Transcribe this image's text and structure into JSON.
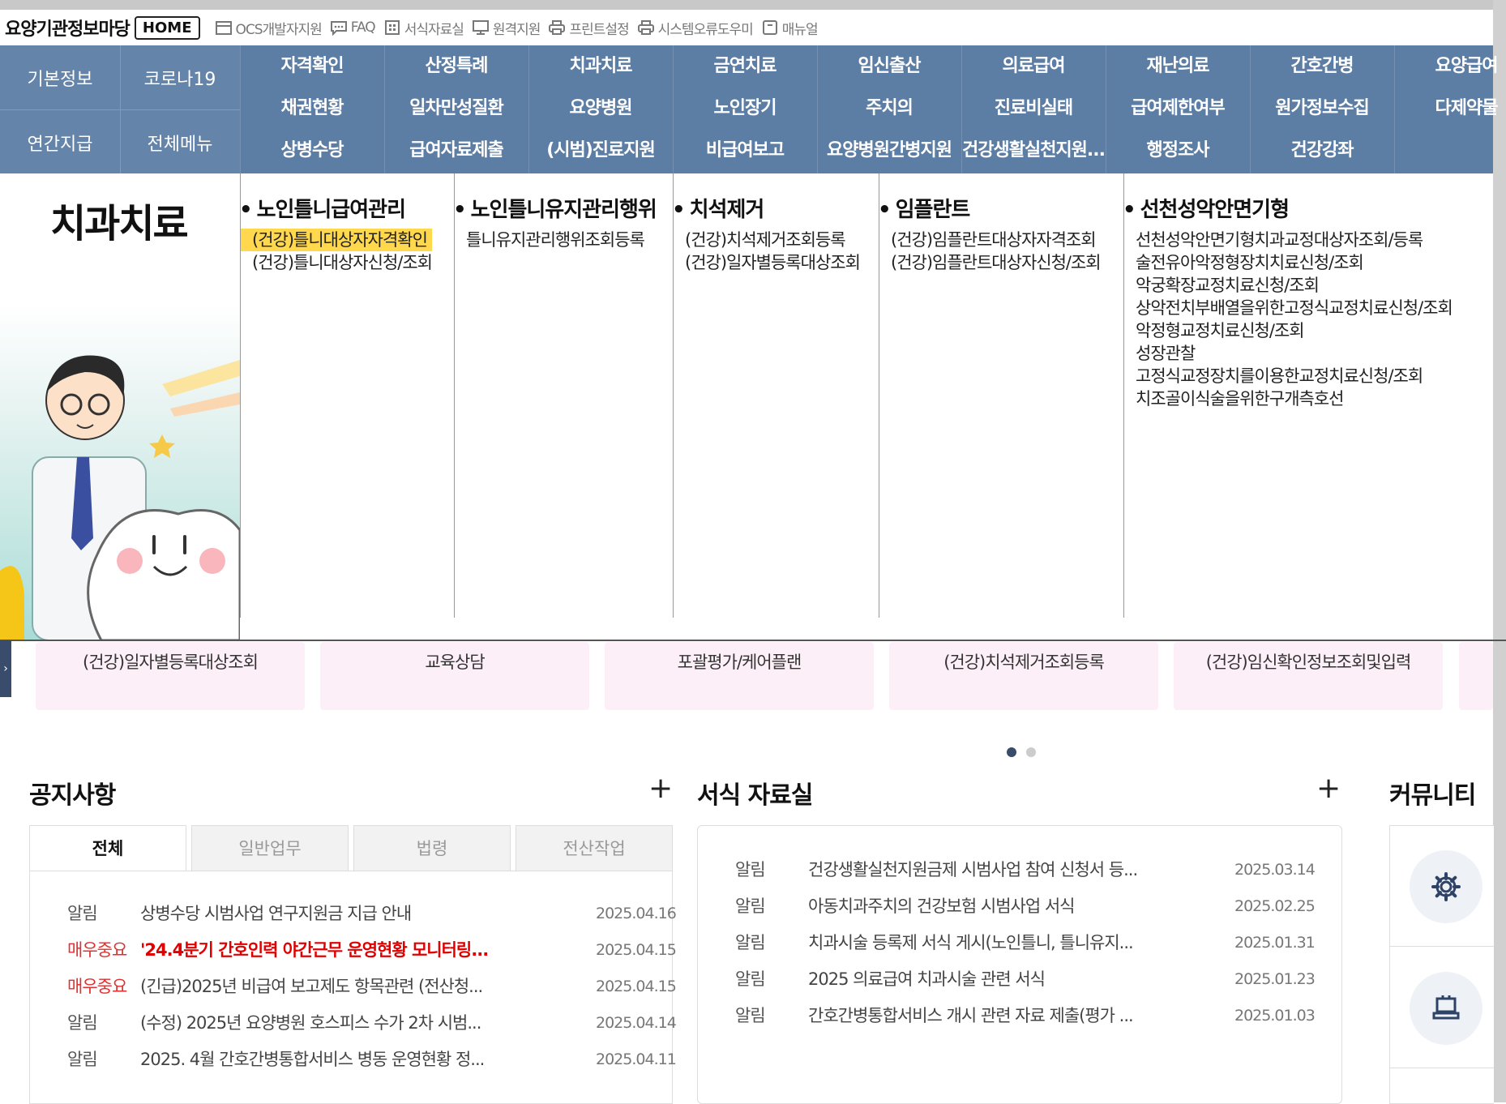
{
  "header": {
    "site_title": "요양기관정보마당",
    "home_label": "HOME",
    "utility_links": [
      {
        "label": "OCS개발자지원",
        "icon": "calendar-icon"
      },
      {
        "label": "FAQ",
        "icon": "chat-icon"
      },
      {
        "label": "서식자료실",
        "icon": "building-icon"
      },
      {
        "label": "원격지원",
        "icon": "monitor-icon"
      },
      {
        "label": "프린트설정",
        "icon": "printer-icon"
      },
      {
        "label": "시스템오류도우미",
        "icon": "printer-icon"
      },
      {
        "label": "매뉴얼",
        "icon": "book-icon"
      }
    ]
  },
  "nav": {
    "side": [
      "기본정보",
      "코로나19",
      "연간지급",
      "전체메뉴"
    ],
    "rows": [
      [
        "자격확인",
        "산정특례",
        "치과치료",
        "금연치료",
        "임신출산",
        "의료급여",
        "재난의료",
        "간호간병",
        "요양급여"
      ],
      [
        "채권현황",
        "일차만성질환",
        "요양병원",
        "노인장기",
        "주치의",
        "진료비실태",
        "급여제한여부",
        "원가정보수집",
        "다제약물"
      ],
      [
        "상병수당",
        "급여자료제출",
        "(시범)진료지원",
        "비급여보고",
        "요양병원간병지원",
        "건강생활실천지원...",
        "행정조사",
        "건강강좌",
        ""
      ]
    ]
  },
  "mega": {
    "title": "치과치료",
    "columns": [
      {
        "heading": "노인틀니급여관리",
        "links": [
          "(건강)틀니대상자자격확인",
          "(건강)틀니대상자신청/조회"
        ],
        "active": 0
      },
      {
        "heading": "노인틀니유지관리행위",
        "links": [
          "틀니유지관리행위조회등록"
        ],
        "active": -1
      },
      {
        "heading": "치석제거",
        "links": [
          "(건강)치석제거조회등록",
          "(건강)일자별등록대상조회"
        ],
        "active": -1
      },
      {
        "heading": "임플란트",
        "links": [
          "(건강)임플란트대상자자격조회",
          "(건강)임플란트대상자신청/조회"
        ],
        "active": -1
      },
      {
        "heading": "선천성악안면기형",
        "links": [
          "선천성악안면기형치과교정대상자조회/등록",
          "술전유아악정형장치치료신청/조회",
          "악궁확장교정치료신청/조회",
          "상악전치부배열을위한고정식교정치료신청/조회",
          "악정형교정치료신청/조회",
          "성장관찰",
          "고정식교정장치를이용한교정치료신청/조회",
          "치조골이식술을위한구개측호선"
        ],
        "active": -1
      }
    ]
  },
  "quick_links": [
    "(건강)일자별등록대상조회",
    "교육상담",
    "포괄평가/케어플랜",
    "(건강)치석제거조회등록",
    "(건강)임신확인정보조회및입력"
  ],
  "notice": {
    "title": "공지사항",
    "more": "+",
    "tabs": [
      "전체",
      "일반업무",
      "법령",
      "전산작업"
    ],
    "items": [
      {
        "cat": "알림",
        "text": "상병수당 시범사업 연구지원금 지급 안내",
        "date": "2025.04.16",
        "hot": false,
        "bold": false
      },
      {
        "cat": "매우중요",
        "text": "'24.4분기 간호인력 야간근무 운영현황 모니터링...",
        "date": "2025.04.15",
        "hot": true,
        "bold": true
      },
      {
        "cat": "매우중요",
        "text": "(긴급)2025년 비급여 보고제도 항목관련 (전산청...",
        "date": "2025.04.15",
        "hot": true,
        "bold": false
      },
      {
        "cat": "알림",
        "text": "(수정) 2025년 요양병원 호스피스 수가 2차 시범...",
        "date": "2025.04.14",
        "hot": false,
        "bold": false
      },
      {
        "cat": "알림",
        "text": "2025. 4월 간호간병통합서비스 병동 운영현황 정...",
        "date": "2025.04.11",
        "hot": false,
        "bold": false
      }
    ]
  },
  "forms": {
    "title": "서식 자료실",
    "more": "+",
    "items": [
      {
        "cat": "알림",
        "text": "건강생활실천지원금제 시범사업 참여 신청서 등...",
        "date": "2025.03.14"
      },
      {
        "cat": "알림",
        "text": "아동치과주치의 건강보험 시범사업 서식",
        "date": "2025.02.25"
      },
      {
        "cat": "알림",
        "text": "치과시술 등록제 서식 게시(노인틀니, 틀니유지...",
        "date": "2025.01.31"
      },
      {
        "cat": "알림",
        "text": "2025 의료급여 치과시술 관련 서식",
        "date": "2025.01.23"
      },
      {
        "cat": "알림",
        "text": "간호간병통합서비스 개시 관련 자료 제출(평가 ...",
        "date": "2025.01.03"
      }
    ]
  },
  "community": {
    "title": "커뮤니티",
    "icons": [
      "gear-icon",
      "laptop-icon"
    ]
  },
  "colors": {
    "nav_bg": "#5d7ea4",
    "active_link": "#ffd84d",
    "hot": "#e03030",
    "card_bg": "#fdeff7"
  }
}
